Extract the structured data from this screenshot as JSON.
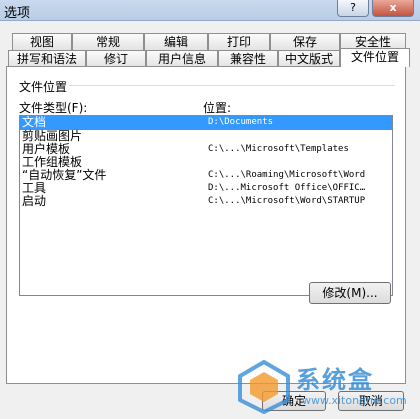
{
  "window": {
    "title": "选项",
    "help_label": "?",
    "close_label": "x"
  },
  "tabs_row1": [
    "视图",
    "常规",
    "编辑",
    "打印",
    "保存",
    "安全性"
  ],
  "tabs_row2": [
    "拼写和语法",
    "修订",
    "用户信息",
    "兼容性",
    "中文版式",
    "文件位置"
  ],
  "active_tab": "文件位置",
  "panel": {
    "group_title": "文件位置",
    "col_type_label": "文件类型(F):",
    "col_location_label": "位置:",
    "rows": [
      {
        "type": "文档",
        "location": "D:\\Documents",
        "selected": true
      },
      {
        "type": "剪贴画图片",
        "location": ""
      },
      {
        "type": "用户模板",
        "location": "C:\\...\\Microsoft\\Templates"
      },
      {
        "type": "工作组模板",
        "location": ""
      },
      {
        "type": "“自动恢复”文件",
        "location": "C:\\...\\Roaming\\Microsoft\\Word"
      },
      {
        "type": "工具",
        "location": "D:\\...Microsoft Office\\OFFIC…"
      },
      {
        "type": "启动",
        "location": "C:\\...\\Microsoft\\Word\\STARTUP"
      }
    ],
    "modify_label": "修改(M)..."
  },
  "buttons": {
    "ok_label": "确定",
    "cancel_label": "取消"
  },
  "watermark": {
    "brand": "系统盒",
    "url": "www.xitonghe.com"
  }
}
